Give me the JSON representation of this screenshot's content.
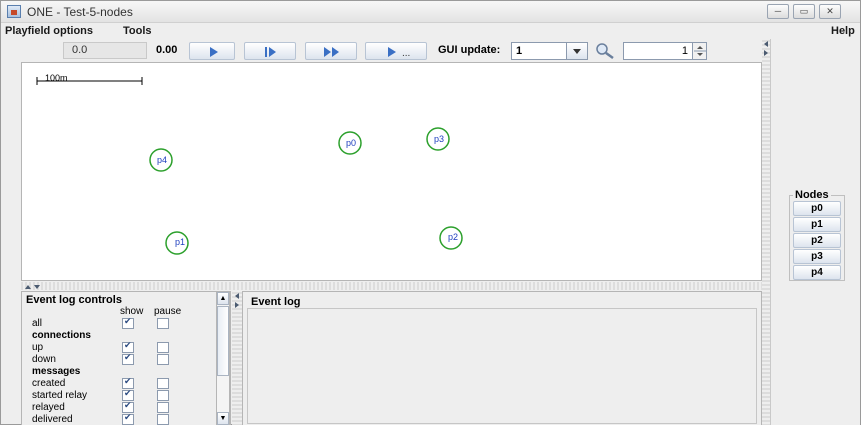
{
  "window": {
    "title": "ONE - Test-5-nodes",
    "buttons": [
      "─",
      "▭",
      "✕"
    ]
  },
  "menubar": {
    "items": [
      "Playfield options",
      "Tools"
    ],
    "help": "Help"
  },
  "toolbar": {
    "sim_time": "0.0",
    "speed": "0.00",
    "gui_update_label": "GUI update:",
    "gui_update_value": "1",
    "zoom_value": "1",
    "play_buttons": [
      "play",
      "step",
      "fast-forward",
      "play-until"
    ],
    "play_until_label": "..."
  },
  "playfield": {
    "scale_label": "100m",
    "nodes": [
      {
        "id": "p0",
        "label": "p0"
      },
      {
        "id": "p3",
        "label": "p3"
      },
      {
        "id": "p4",
        "label": "p4"
      },
      {
        "id": "p1",
        "label": "p1"
      },
      {
        "id": "p2",
        "label": "p2"
      }
    ],
    "node_color": "#2ca02c",
    "label_color": "#1f3fbf"
  },
  "nodes_panel": {
    "title": "Nodes",
    "items": [
      "p0",
      "p1",
      "p2",
      "p3",
      "p4"
    ]
  },
  "event_log_controls": {
    "title": "Event log controls",
    "col_show": "show",
    "col_pause": "pause",
    "rows": [
      {
        "label": "all",
        "type": "row",
        "show": true,
        "pause": false
      },
      {
        "label": "connections",
        "type": "section"
      },
      {
        "label": "up",
        "type": "row",
        "show": true,
        "pause": false
      },
      {
        "label": "down",
        "type": "row",
        "show": true,
        "pause": false
      },
      {
        "label": "messages",
        "type": "section"
      },
      {
        "label": "created",
        "type": "row",
        "show": true,
        "pause": false
      },
      {
        "label": "started relay",
        "type": "row",
        "show": true,
        "pause": false
      },
      {
        "label": "relayed",
        "type": "row",
        "show": true,
        "pause": false
      },
      {
        "label": "delivered",
        "type": "row",
        "show": true,
        "pause": false
      }
    ]
  },
  "event_log": {
    "title": "Event log"
  }
}
